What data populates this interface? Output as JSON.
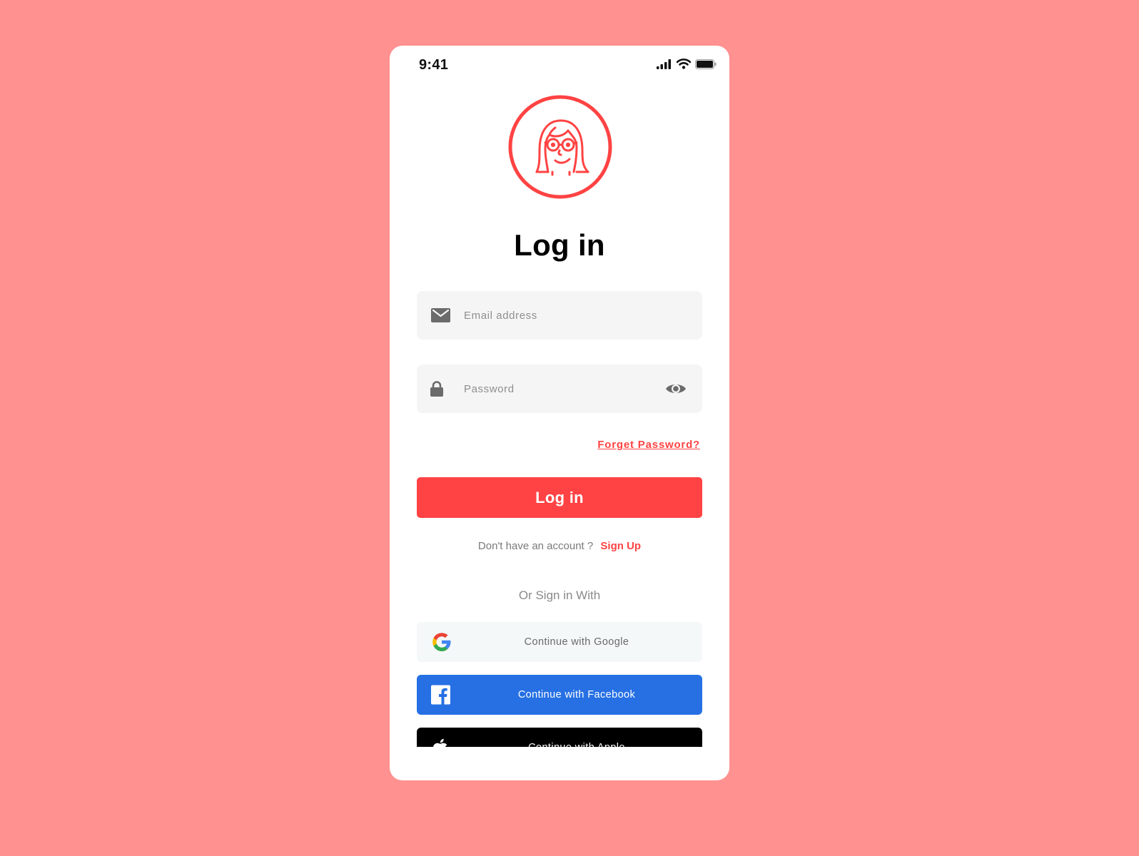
{
  "status_bar": {
    "time": "9:41",
    "icons": [
      "signal-icon",
      "wifi-icon",
      "battery-icon"
    ]
  },
  "avatar": {
    "icon": "woman-with-glasses-avatar",
    "color": "#ff4343"
  },
  "page": {
    "title": "Log in"
  },
  "form": {
    "email": {
      "placeholder": "Email address",
      "value": "",
      "icon": "envelope-icon"
    },
    "password": {
      "placeholder": "Password",
      "value": "",
      "icon": "lock-icon",
      "toggle_icon": "eye-icon"
    },
    "forgot_label": "Forget Password?",
    "submit_label": "Log in"
  },
  "signup": {
    "prompt": "Don't have an account ?",
    "link_label": "Sign Up"
  },
  "social": {
    "divider_label": "Or Sign in With",
    "google_label": "Continue with Google",
    "facebook_label": "Continue with Facebook",
    "apple_label": "Continue with Apple"
  },
  "colors": {
    "background": "#ff9190",
    "accent": "#ff4244",
    "facebook": "#2670e4",
    "apple": "#000000",
    "field_bg": "#f5f5f5"
  }
}
